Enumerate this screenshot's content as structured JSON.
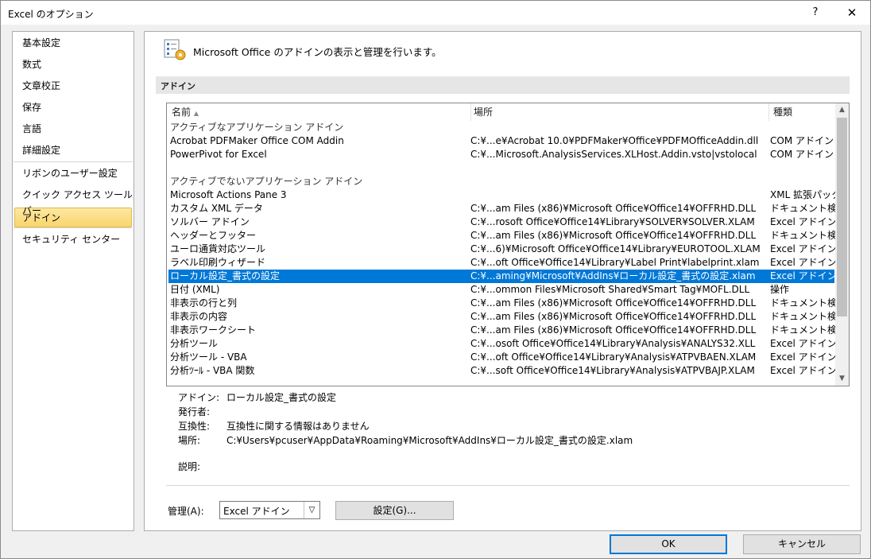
{
  "window": {
    "title": "Excel のオプション",
    "help_glyph": "?",
    "close_glyph": "✕"
  },
  "nav": {
    "items": [
      "基本設定",
      "数式",
      "文章校正",
      "保存",
      "言語",
      "詳細設定",
      "リボンのユーザー設定",
      "クイック アクセス ツール バー",
      "アドイン",
      "セキュリティ センター"
    ],
    "active": "アドイン"
  },
  "header": {
    "text": "Microsoft Office のアドインの表示と管理を行います。"
  },
  "section": {
    "label": "アドイン"
  },
  "grid": {
    "columns": {
      "name": "名前",
      "sort_glyph": "▲",
      "location": "場所",
      "type": "種類"
    },
    "groups": [
      "アクティブなアプリケーション アドイン",
      "アクティブでないアプリケーション アドイン"
    ],
    "active_rows": [
      {
        "name": "Acrobat PDFMaker Office COM Addin",
        "location": "C:¥...e¥Acrobat 10.0¥PDFMaker¥Office¥PDFMOfficeAddin.dll",
        "type": "COM アドイン"
      },
      {
        "name": "PowerPivot for Excel",
        "location": "C:¥...Microsoft.AnalysisServices.XLHost.Addin.vsto|vstolocal",
        "type": "COM アドイン"
      }
    ],
    "inactive_rows": [
      {
        "name": "Microsoft Actions Pane 3",
        "location": "",
        "type": "XML 拡張パック"
      },
      {
        "name": "カスタム XML データ",
        "location": "C:¥...am Files (x86)¥Microsoft Office¥Office14¥OFFRHD.DLL",
        "type": "ドキュメント検査"
      },
      {
        "name": "ソルバー アドイン",
        "location": "C:¥...rosoft Office¥Office14¥Library¥SOLVER¥SOLVER.XLAM",
        "type": "Excel アドイン"
      },
      {
        "name": "ヘッダーとフッター",
        "location": "C:¥...am Files (x86)¥Microsoft Office¥Office14¥OFFRHD.DLL",
        "type": "ドキュメント検査"
      },
      {
        "name": "ユーロ通貨対応ツール",
        "location": "C:¥...6)¥Microsoft Office¥Office14¥Library¥EUROTOOL.XLAM",
        "type": "Excel アドイン"
      },
      {
        "name": "ラベル印刷ウィザード",
        "location": "C:¥...oft Office¥Office14¥Library¥Label Print¥labelprint.xlam",
        "type": "Excel アドイン"
      },
      {
        "name": "ローカル設定_書式の設定",
        "location": "C:¥...aming¥Microsoft¥AddIns¥ローカル設定_書式の設定.xlam",
        "type": "Excel アドイン",
        "selected": true
      },
      {
        "name": "日付 (XML)",
        "location": "C:¥...ommon Files¥Microsoft Shared¥Smart Tag¥MOFL.DLL",
        "type": "操作"
      },
      {
        "name": "非表示の行と列",
        "location": "C:¥...am Files (x86)¥Microsoft Office¥Office14¥OFFRHD.DLL",
        "type": "ドキュメント検査"
      },
      {
        "name": "非表示の内容",
        "location": "C:¥...am Files (x86)¥Microsoft Office¥Office14¥OFFRHD.DLL",
        "type": "ドキュメント検査"
      },
      {
        "name": "非表示ワークシート",
        "location": "C:¥...am Files (x86)¥Microsoft Office¥Office14¥OFFRHD.DLL",
        "type": "ドキュメント検査"
      },
      {
        "name": "分析ツール",
        "location": "C:¥...osoft Office¥Office14¥Library¥Analysis¥ANALYS32.XLL",
        "type": "Excel アドイン"
      },
      {
        "name": "分析ツール - VBA",
        "location": "C:¥...oft Office¥Office14¥Library¥Analysis¥ATPVBAEN.XLAM",
        "type": "Excel アドイン"
      },
      {
        "name": "分析ﾂｰﾙ - VBA 関数",
        "location": "C:¥...soft Office¥Office14¥Library¥Analysis¥ATPVBAJP.XLAM",
        "type": "Excel アドイン"
      }
    ]
  },
  "details": {
    "addin_label": "アドイン:",
    "addin_value": "ローカル設定_書式の設定",
    "publisher_label": "発行者:",
    "publisher_value": "",
    "compat_label": "互換性:",
    "compat_value": "互換性に関する情報はありません",
    "location_label": "場所:",
    "location_value": "C:¥Users¥pcuser¥AppData¥Roaming¥Microsoft¥AddIns¥ローカル設定_書式の設定.xlam",
    "description_label": "説明:"
  },
  "manage": {
    "label": "管理(A):",
    "selected": "Excel アドイン",
    "go_label": "設定(G)..."
  },
  "buttons": {
    "ok": "OK",
    "cancel": "キャンセル"
  },
  "colors": {
    "selection": "#0078d7",
    "nav_active": "#f9d56c",
    "ok_border": "#0078d7"
  }
}
